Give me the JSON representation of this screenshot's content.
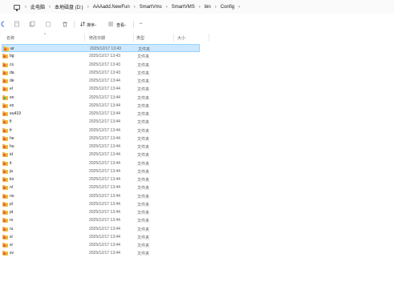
{
  "breadcrumb": {
    "items": [
      "此电脑",
      "本地磁盘 (D:)",
      "AAAadd.NewFun",
      "SmartVms",
      "SmartVMS",
      "bin",
      "Config"
    ]
  },
  "toolbar": {
    "sort_label": "排序",
    "view_label": "查看",
    "more_label": "···"
  },
  "columns": {
    "name": "名称",
    "date": "修改日期",
    "type": "类型",
    "size": "大小"
  },
  "files": [
    {
      "name": "ar",
      "date": "2025/12/17 13:43",
      "type": "文件夹",
      "selected": true,
      "badge": "orange"
    },
    {
      "name": "bg",
      "date": "2025/12/17 13:43",
      "type": "文件夹",
      "badge": "orange"
    },
    {
      "name": "cs",
      "date": "2025/12/17 13:43",
      "type": "文件夹",
      "badge": "orange"
    },
    {
      "name": "da",
      "date": "2025/12/17 13:43",
      "type": "文件夹",
      "badge": "orange"
    },
    {
      "name": "de",
      "date": "2025/12/17 13:44",
      "type": "文件夹",
      "badge": "orange"
    },
    {
      "name": "el",
      "date": "2025/12/17 13:44",
      "type": "文件夹",
      "badge": "orange"
    },
    {
      "name": "en",
      "date": "2025/12/17 13:44",
      "type": "文件夹",
      "badge": "green"
    },
    {
      "name": "es",
      "date": "2025/12/17 13:44",
      "type": "文件夹",
      "badge": "orange"
    },
    {
      "name": "eu419",
      "date": "2025/12/17 13:44",
      "type": "文件夹",
      "badge": "orange"
    },
    {
      "name": "fi",
      "date": "2025/12/17 13:44",
      "type": "文件夹",
      "badge": "orange"
    },
    {
      "name": "fr",
      "date": "2025/12/17 13:44",
      "type": "文件夹",
      "badge": "orange"
    },
    {
      "name": "he",
      "date": "2025/12/17 13:44",
      "type": "文件夹",
      "badge": "orange"
    },
    {
      "name": "hu",
      "date": "2025/12/17 13:44",
      "type": "文件夹",
      "badge": "orange"
    },
    {
      "name": "id",
      "date": "2025/12/17 13:44",
      "type": "文件夹",
      "badge": "orange"
    },
    {
      "name": "it",
      "date": "2025/12/17 13:44",
      "type": "文件夹",
      "badge": "orange"
    },
    {
      "name": "ja",
      "date": "2025/12/17 13:44",
      "type": "文件夹",
      "badge": "orange"
    },
    {
      "name": "ko",
      "date": "2025/12/17 13:44",
      "type": "文件夹",
      "badge": "orange"
    },
    {
      "name": "nl",
      "date": "2025/12/17 13:44",
      "type": "文件夹",
      "badge": "orange"
    },
    {
      "name": "no",
      "date": "2025/12/17 13:44",
      "type": "文件夹",
      "badge": "orange"
    },
    {
      "name": "pl",
      "date": "2025/12/17 13:44",
      "type": "文件夹",
      "badge": "orange"
    },
    {
      "name": "pt",
      "date": "2025/12/17 13:44",
      "type": "文件夹",
      "badge": "orange"
    },
    {
      "name": "ro",
      "date": "2025/12/17 13:44",
      "type": "文件夹",
      "badge": "orange"
    },
    {
      "name": "ru",
      "date": "2025/12/17 13:44",
      "type": "文件夹",
      "badge": "orange"
    },
    {
      "name": "sl",
      "date": "2025/12/17 13:44",
      "type": "文件夹",
      "badge": "orange"
    },
    {
      "name": "sr",
      "date": "2025/12/17 13:44",
      "type": "文件夹",
      "badge": "orange"
    },
    {
      "name": "sv",
      "date": "2025/12/17 13:44",
      "type": "文件夹",
      "badge": "orange"
    }
  ],
  "colors": {
    "selection_bg": "#cce8ff",
    "selection_border": "#99d1ff",
    "folder": "#f3b53c"
  }
}
